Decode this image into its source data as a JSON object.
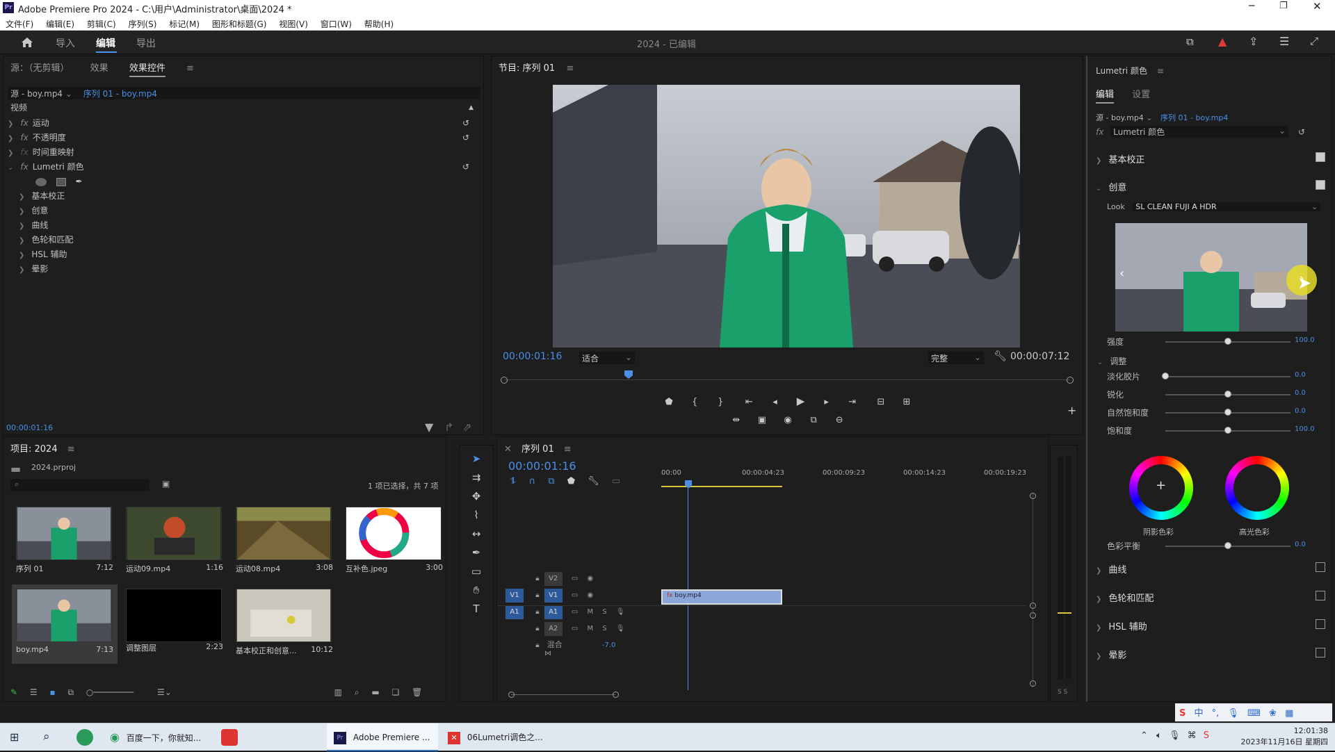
{
  "titlebar": {
    "title": "Adobe Premiere Pro 2024 - C:\\用户\\Administrator\\桌面\\2024 *"
  },
  "menu": [
    "文件(F)",
    "编辑(E)",
    "剪辑(C)",
    "序列(S)",
    "标记(M)",
    "图形和标题(G)",
    "视图(V)",
    "窗口(W)",
    "帮助(H)"
  ],
  "workspace": {
    "tabs": [
      "导入",
      "编辑",
      "导出"
    ],
    "active": "编辑",
    "project_title": "2024 - 已编辑"
  },
  "source_panel": {
    "tabs": [
      "源：（无剪辑）",
      "效果",
      "效果控件"
    ],
    "source_dropdown": "源 - boy.mp4",
    "sequence_link": "序列 01 - boy.mp4",
    "video_header": "视频",
    "effects": [
      "运动",
      "不透明度",
      "时间重映射",
      "Lumetri 颜色"
    ],
    "lumetri_sub": [
      "基本校正",
      "创意",
      "曲线",
      "色轮和匹配",
      "HSL 辅助",
      "晕影"
    ],
    "timecode": "00:00:01:16"
  },
  "program_monitor": {
    "title": "节目: 序列 01",
    "timecode": "00:00:01:16",
    "fit": "适合",
    "quality": "完整",
    "duration": "00:00:07:12",
    "playhead_fraction": 0.22
  },
  "project_panel": {
    "title": "项目: 2024",
    "file": "2024.prproj",
    "selection_info": "1 项已选择，共 7 项",
    "items": [
      {
        "name": "序列 01",
        "duration": "7:12"
      },
      {
        "name": "运动09.mp4",
        "duration": "1:16"
      },
      {
        "name": "运动08.mp4",
        "duration": "3:08"
      },
      {
        "name": "互补色.jpeg",
        "duration": "3:00"
      },
      {
        "name": "boy.mp4",
        "duration": "7:13"
      },
      {
        "name": "调整图层",
        "duration": "2:23"
      },
      {
        "name": "基本校正和创意...",
        "duration": "10:12"
      }
    ]
  },
  "timeline": {
    "title": "序列 01",
    "timecode": "00:00:01:16",
    "ruler": [
      "00:00",
      "00:00:04:23",
      "00:00:09:23",
      "00:00:14:23",
      "00:00:19:23"
    ],
    "tracks": [
      "V2",
      "V1",
      "A1",
      "A2"
    ],
    "source_v1": "V1",
    "source_a1": "A1",
    "mix_label": "混合",
    "mix_value": "-7.0",
    "clip_name": "boy.mp4",
    "meter_label": "S S"
  },
  "lumetri": {
    "title": "Lumetri 颜色",
    "tabs": [
      "编辑",
      "设置"
    ],
    "source_dropdown": "源 - boy.mp4",
    "sequence_link": "序列 01 - boy.mp4",
    "effect_name": "Lumetri 颜色",
    "sections": {
      "basic": "基本校正",
      "creative": "创意",
      "curves": "曲线",
      "wheels": "色轮和匹配",
      "hsl": "HSL 辅助",
      "vignette": "晕影"
    },
    "look_label": "Look",
    "look_value": "SL CLEAN FUJI A HDR",
    "intensity_label": "强度",
    "intensity_value": "100.0",
    "adjust_label": "调整",
    "sliders": [
      {
        "label": "淡化胶片",
        "value": "0.0",
        "fraction": 0.0
      },
      {
        "label": "锐化",
        "value": "0.0",
        "fraction": 0.5
      },
      {
        "label": "自然饱和度",
        "value": "0.0",
        "fraction": 0.5
      },
      {
        "label": "饱和度",
        "value": "100.0",
        "fraction": 0.5
      }
    ],
    "wheel_shadow": "阴影色彩",
    "wheel_highlight": "高光色彩",
    "color_balance_label": "色彩平衡",
    "color_balance_value": "0.0"
  },
  "taskbar": {
    "items": [
      "百度一下，你就知...",
      "Adobe Premiere ...",
      "06Lumetri调色之..."
    ],
    "time": "12:01:38",
    "date": "2023年11月16日 星期四",
    "ime": "中"
  }
}
